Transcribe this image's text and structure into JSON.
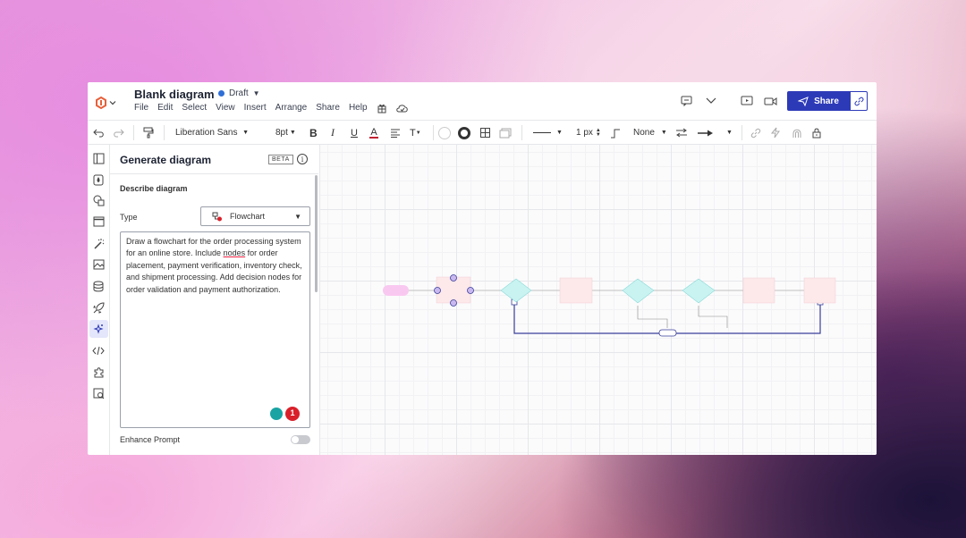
{
  "header": {
    "title": "Blank diagram",
    "status": "Draft",
    "menu": [
      "File",
      "Edit",
      "Select",
      "View",
      "Insert",
      "Arrange",
      "Share",
      "Help"
    ],
    "share_label": "Share"
  },
  "toolbar": {
    "font": "Liberation Sans",
    "font_size": "8pt",
    "line_width": "1 px",
    "arrow_start": "None"
  },
  "panel": {
    "title": "Generate diagram",
    "beta": "BETA",
    "info": "i",
    "describe_label": "Describe diagram",
    "type_label": "Type",
    "type_value": "Flowchart",
    "prompt_before": "Draw a flowchart for the order processing system for an online store. Include ",
    "prompt_underlined": "nodes",
    "prompt_after": " for order placement, payment verification, inventory check, and shipment processing. Add decision nodes for order validation and payment authorization.",
    "error_count": "1",
    "enhance_label": "Enhance Prompt"
  },
  "colors": {
    "accent": "#2d3ab8",
    "brand_orange": "#e8603a",
    "error": "#d9202a",
    "assist": "#19a3a3",
    "node_pink": "#fde8ea",
    "node_cyan": "#c8f3f0",
    "start_pink": "#f9c8f0"
  },
  "icons": {
    "rail": [
      "panel-icon",
      "paint-drop-icon",
      "shapes-icon",
      "browser-icon",
      "magic-wand-icon",
      "image-icon",
      "database-icon",
      "rocket-icon",
      "sparkle-icon",
      "code-icon",
      "puzzle-icon",
      "search-image-icon"
    ]
  }
}
